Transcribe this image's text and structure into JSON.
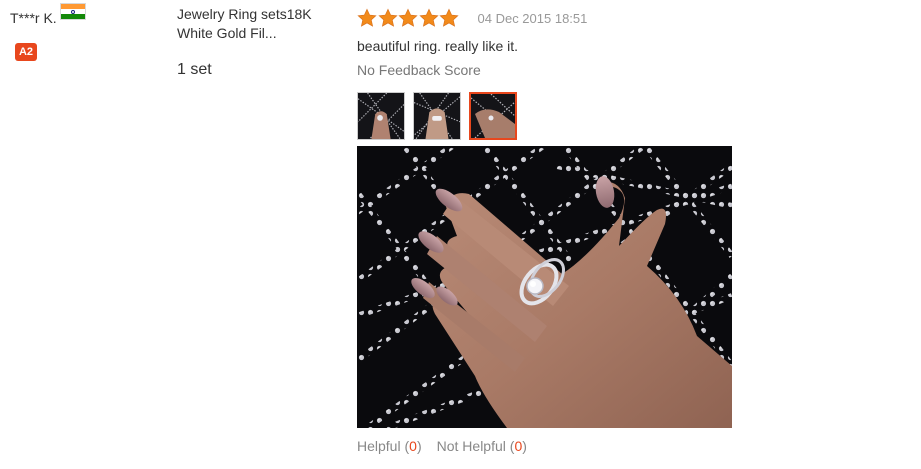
{
  "buyer": {
    "name": "T***r K.",
    "country_flag": "india-flag",
    "level_badge": "A2"
  },
  "product": {
    "title": "Jewelry Ring sets18K White Gold Fil...",
    "quantity": "1 set"
  },
  "review": {
    "rating": 5,
    "rating_max": 5,
    "star_color": "#f28a1a",
    "date": "04 Dec 2015 18:51",
    "text": "beautiful ring. really like it.",
    "feedback_score": "No Feedback Score",
    "thumbnails": [
      {
        "name": "review-photo-1",
        "selected": false
      },
      {
        "name": "review-photo-2",
        "selected": false
      },
      {
        "name": "review-photo-3",
        "selected": true
      }
    ],
    "main_image": "hand-with-ring-photo",
    "helpful": {
      "label": "Helpful",
      "open": "(",
      "count": "0",
      "close": ")"
    },
    "not_helpful": {
      "label": "Not Helpful",
      "open": "(",
      "count": "0",
      "close": ")"
    }
  },
  "colors": {
    "accent": "#e8471d",
    "muted_text": "#999999"
  }
}
